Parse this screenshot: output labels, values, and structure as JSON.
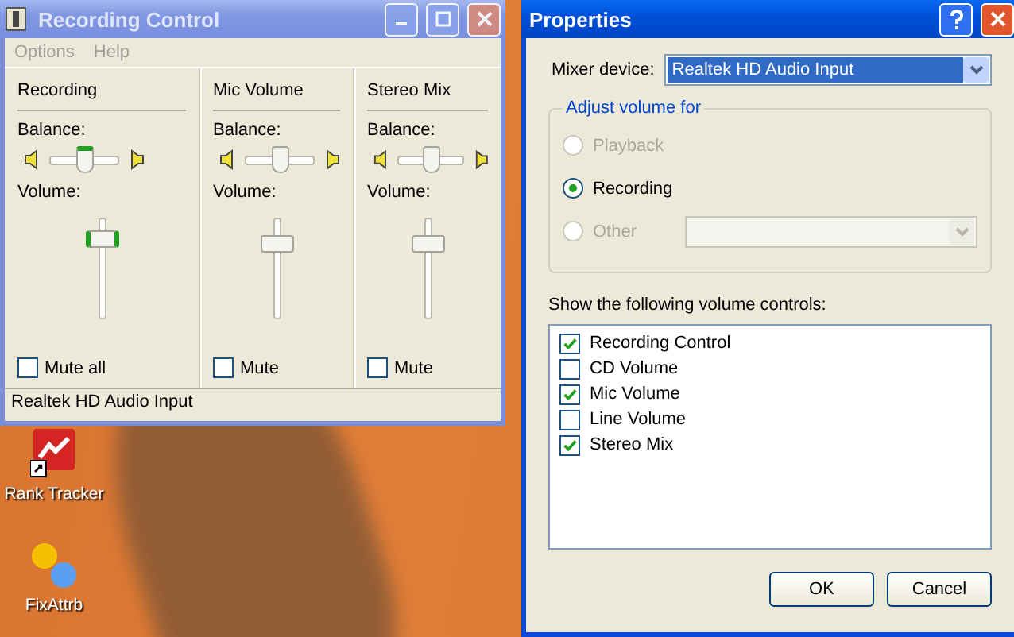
{
  "desktop": {
    "icons": [
      {
        "label": "Rank Tracker",
        "kind": "tracker"
      },
      {
        "label": "FixAttrb",
        "kind": "dots"
      }
    ]
  },
  "recording_control": {
    "title": "Recording Control",
    "active": false,
    "menu": [
      {
        "label": "Options",
        "disabled": true
      },
      {
        "label": "Help",
        "disabled": true
      }
    ],
    "channels": [
      {
        "name": "Recording",
        "balance_label": "Balance:",
        "balance": {
          "level": 0.5
        },
        "volume_label": "Volume:",
        "volume": {
          "level": 0.85
        },
        "mute": {
          "label": "Mute all",
          "checked": false
        },
        "focused": true
      },
      {
        "name": "Mic Volume",
        "balance_label": "Balance:",
        "balance": {
          "level": 0.5
        },
        "volume_label": "Volume:",
        "volume": {
          "level": 0.8
        },
        "mute": {
          "label": "Mute",
          "checked": false
        },
        "focused": false
      },
      {
        "name": "Stereo Mix",
        "balance_label": "Balance:",
        "balance": {
          "level": 0.5
        },
        "volume_label": "Volume:",
        "volume": {
          "level": 0.8
        },
        "mute": {
          "label": "Mute",
          "checked": false
        },
        "focused": false
      }
    ],
    "status_bar": "Realtek HD Audio Input"
  },
  "properties": {
    "title": "Properties",
    "active": true,
    "mixer_device": {
      "label": "Mixer device:",
      "value": "Realtek HD Audio Input"
    },
    "adjust_group": {
      "title": "Adjust volume for",
      "options": [
        {
          "label": "Playback",
          "selected": false,
          "disabled": true
        },
        {
          "label": "Recording",
          "selected": true,
          "disabled": false
        },
        {
          "label": "Other",
          "selected": false,
          "disabled": true,
          "kind": "with-dropdown"
        }
      ]
    },
    "controls_label": "Show the following volume controls:",
    "controls": [
      {
        "label": "Recording Control",
        "checked": true
      },
      {
        "label": "CD Volume",
        "checked": false
      },
      {
        "label": "Mic Volume",
        "checked": true
      },
      {
        "label": "Line Volume",
        "checked": false
      },
      {
        "label": "Stereo Mix",
        "checked": true
      }
    ],
    "buttons": [
      "OK",
      "Cancel"
    ]
  }
}
